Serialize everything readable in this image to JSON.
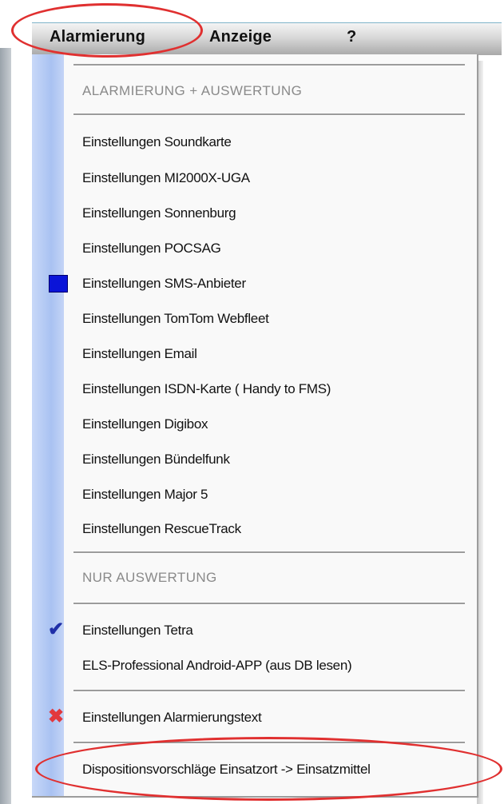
{
  "menubar": {
    "items": [
      {
        "label": "Alarmierung"
      },
      {
        "label": "Anzeige"
      },
      {
        "label": "?"
      }
    ]
  },
  "menu": {
    "section1_header": "ALARMIERUNG + AUSWERTUNG",
    "section1_items": [
      {
        "label": "Einstellungen Soundkarte"
      },
      {
        "label": "Einstellungen MI2000X-UGA"
      },
      {
        "label": "Einstellungen Sonnenburg"
      },
      {
        "label": "Einstellungen POCSAG"
      },
      {
        "label": "Einstellungen SMS-Anbieter",
        "icon": "blue-square-icon"
      },
      {
        "label": "Einstellungen TomTom Webfleet"
      },
      {
        "label": "Einstellungen Email"
      },
      {
        "label": "Einstellungen ISDN-Karte ( Handy to FMS)"
      },
      {
        "label": "Einstellungen Digibox"
      },
      {
        "label": "Einstellungen Bündelfunk"
      },
      {
        "label": "Einstellungen Major 5"
      },
      {
        "label": "Einstellungen RescueTrack"
      }
    ],
    "section2_header": "NUR AUSWERTUNG",
    "section2_items": [
      {
        "label": "Einstellungen Tetra",
        "icon": "checkmark-icon"
      },
      {
        "label": "ELS-Professional Android-APP (aus DB lesen)"
      }
    ],
    "section3_items": [
      {
        "label": "Einstellungen Alarmierungstext",
        "icon": "red-x-icon"
      }
    ],
    "section4_items": [
      {
        "label": "Dispositionsvorschläge Einsatzort -> Einsatzmittel"
      }
    ]
  },
  "icons": {
    "square": "■",
    "check": "✔",
    "x": "✖"
  },
  "colors": {
    "highlight_circle": "#e03030",
    "gutter": "#a9c2f2",
    "square_icon": "#0a14d8",
    "check_icon": "#1f2fa8",
    "x_icon": "#e2383d"
  }
}
